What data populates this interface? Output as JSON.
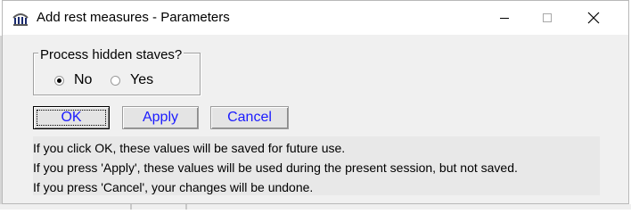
{
  "window": {
    "title": "Add rest measures - Parameters",
    "controls": [
      "minimize",
      "maximize",
      "close"
    ]
  },
  "options": {
    "legend": "Process hidden staves?",
    "radios": [
      {
        "label": "No",
        "checked": true
      },
      {
        "label": "Yes",
        "checked": false
      }
    ]
  },
  "buttons": {
    "ok": "OK",
    "apply": "Apply",
    "cancel": "Cancel"
  },
  "info": {
    "line1": "If you click OK, these values will be saved for future use.",
    "line2": "If you press 'Apply', these values will be used during the present session, but not saved.",
    "line3": "If you press 'Cancel', your changes will be undone."
  },
  "colors": {
    "button_text": "#1a1aff",
    "dialog_bg": "#f0f0f0"
  }
}
